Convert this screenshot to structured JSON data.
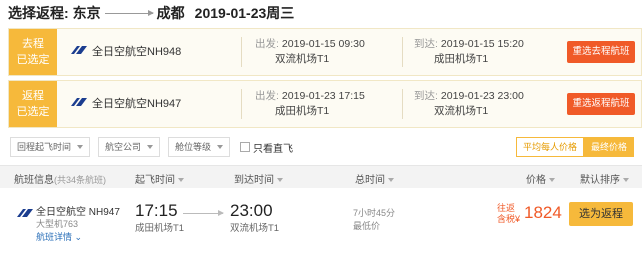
{
  "header": {
    "label": "选择返程:",
    "origin": "东京",
    "destination": "成都",
    "date": "2019-01-23周三"
  },
  "segments": [
    {
      "badge_line1": "去程",
      "badge_line2": "已选定",
      "flight": "全日空航空NH948",
      "dep_label": "出发:",
      "dep_time": "2019-01-15 09:30",
      "dep_airport": "双流机场T1",
      "arr_label": "到达:",
      "arr_time": "2019-01-15 15:20",
      "arr_airport": "成田机场T1",
      "reselect": "重选去程航班"
    },
    {
      "badge_line1": "返程",
      "badge_line2": "已选定",
      "flight": "全日空航空NH947",
      "dep_label": "出发:",
      "dep_time": "2019-01-23 17:15",
      "dep_airport": "成田机场T1",
      "arr_label": "到达:",
      "arr_time": "2019-01-23 23:00",
      "arr_airport": "双流机场T1",
      "reselect": "重选返程航班"
    }
  ],
  "filters": {
    "time": "回程起飞时间",
    "airline": "航空公司",
    "cabin": "舱位等级",
    "direct_only": "只看直飞"
  },
  "price_mode": {
    "per_person": "平均每人价格",
    "total": "最终价格"
  },
  "table_header": {
    "flight_info": "航班信息",
    "flight_count": "(共34条航班)",
    "dep_time": "起飞时间",
    "arr_time": "到达时间",
    "total_time": "总时间",
    "price": "价格",
    "sort": "默认排序"
  },
  "result": {
    "airline": "全日空航空 NH947",
    "aircraft": "大型机763",
    "detail_link": "航班详情",
    "dep_time": "17:15",
    "dep_airport": "成田机场T1",
    "arr_time": "23:00",
    "arr_airport": "双流机场T1",
    "duration": "7小时45分",
    "stops": "最低价",
    "price_label_1": "往返",
    "price_label_2": "含税¥",
    "price": "1824",
    "book": "选为返程"
  }
}
